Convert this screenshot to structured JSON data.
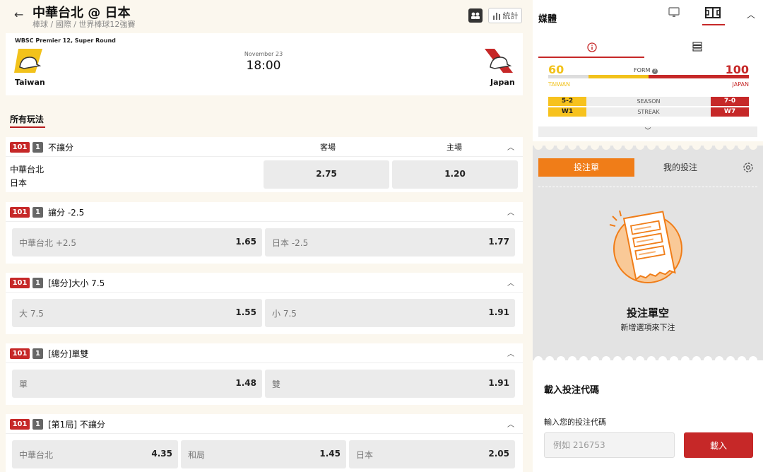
{
  "header": {
    "back_icon": "arrow-left-icon",
    "title": "中華台北 @ 日本",
    "breadcrumb": "棒球 / 國際 / 世界棒球12強賽",
    "stats_label": "統計"
  },
  "match": {
    "competition": "WBSC Premier 12, Super Round",
    "date": "November 23",
    "time": "18:00",
    "home_team": "Taiwan",
    "away_team": "Japan"
  },
  "tabs": {
    "all": "所有玩法"
  },
  "markets": [
    {
      "code": "101",
      "period": "1",
      "title": "不讓分",
      "col_away": "客場",
      "col_home": "主場",
      "rows": [
        {
          "teams": [
            "中華台北",
            "日本"
          ],
          "odds": [
            "2.75",
            "1.20"
          ]
        }
      ]
    },
    {
      "code": "101",
      "period": "1",
      "title": "讓分 -2.5",
      "options": [
        {
          "label": "中華台北 +2.5",
          "odds": "1.65"
        },
        {
          "label": "日本 -2.5",
          "odds": "1.77"
        }
      ]
    },
    {
      "code": "101",
      "period": "1",
      "title": "[總分]大小 7.5",
      "options": [
        {
          "label": "大 7.5",
          "odds": "1.55"
        },
        {
          "label": "小 7.5",
          "odds": "1.91"
        }
      ]
    },
    {
      "code": "101",
      "period": "1",
      "title": "[總分]單雙",
      "options": [
        {
          "label": "單",
          "odds": "1.48"
        },
        {
          "label": "雙",
          "odds": "1.91"
        }
      ]
    },
    {
      "code": "101",
      "period": "1",
      "title": "[第1局] 不讓分",
      "options": [
        {
          "label": "中華台北",
          "odds": "4.35"
        },
        {
          "label": "和局",
          "odds": "1.45"
        },
        {
          "label": "日本",
          "odds": "2.05"
        }
      ]
    }
  ],
  "side": {
    "media_title": "媒體",
    "form": {
      "home_value": 60,
      "away_value": 100,
      "label": "FORM",
      "home_team": "TAIWAN",
      "away_team": "JAPAN",
      "season": {
        "label": "SEASON",
        "home": "5-2",
        "away": "7-0"
      },
      "streak": {
        "label": "STREAK",
        "home": "W1",
        "away": "W7"
      }
    },
    "betslip": {
      "tab_active": "投注單",
      "tab_other": "我的投注",
      "empty_title": "投注單空",
      "empty_sub": "新增選項來下注"
    },
    "code": {
      "title": "載入投注代碼",
      "label": "輸入您的投注代碼",
      "placeholder": "例如 216753",
      "button": "載入"
    }
  },
  "colors": {
    "accent": "#c62828",
    "orange": "#f07d18",
    "yellow": "#f2c21b"
  }
}
